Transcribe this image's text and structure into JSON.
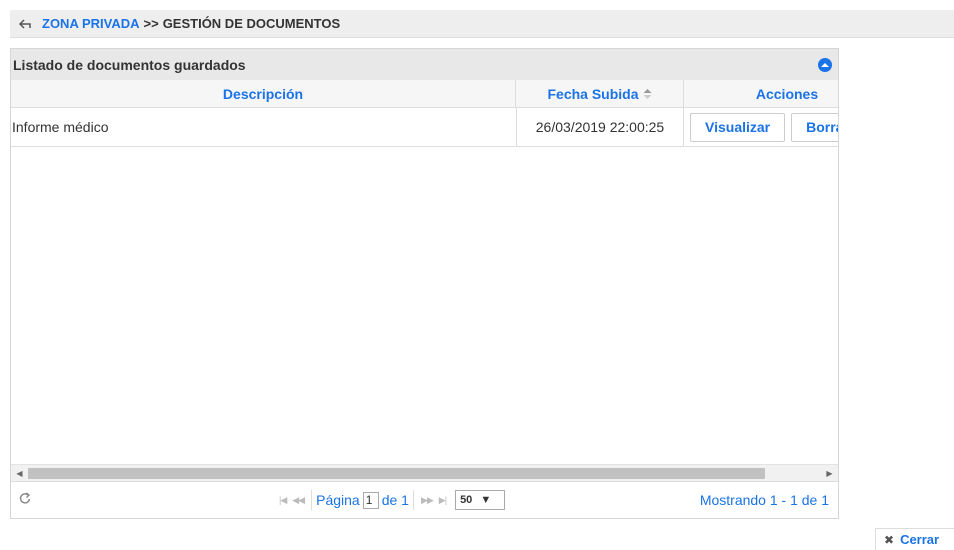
{
  "breadcrumb": {
    "back_icon": "back-arrow-icon",
    "link": "ZONA PRIVADA",
    "separator": ">>",
    "current": "GESTIÓN DE DOCUMENTOS"
  },
  "grid": {
    "title": "Listado de documentos guardados",
    "columns": {
      "description": "Descripción",
      "upload_date": "Fecha Subida",
      "actions": "Acciones"
    },
    "rows": [
      {
        "description": "Informe médico",
        "upload_date": "26/03/2019 22:00:25",
        "actions": [
          "Visualizar",
          "Borrar"
        ]
      }
    ]
  },
  "pager": {
    "page_label": "Página",
    "page_value": "1",
    "of_label": "de 1",
    "page_size": "50",
    "showing": "Mostrando 1 - 1 de 1"
  },
  "close_button": "Cerrar",
  "colors": {
    "accent": "#1a73e8",
    "header_bg": "#e8e8e8",
    "border": "#dddddd"
  }
}
